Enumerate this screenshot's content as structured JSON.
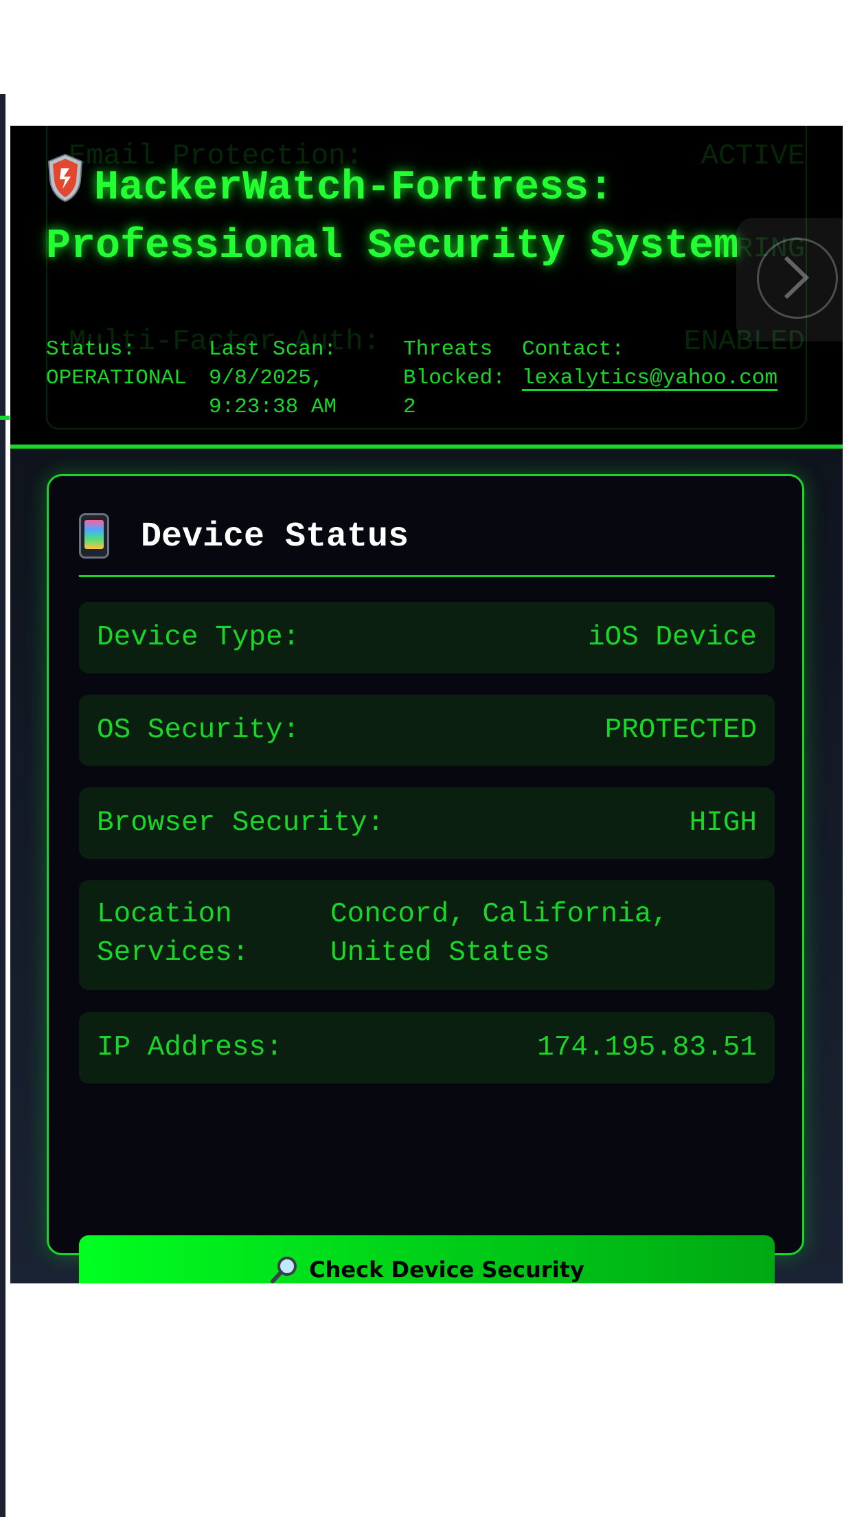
{
  "header": {
    "title": "HackerWatch-Fortress: Professional Security System",
    "background_rows": [
      {
        "label": "Email Protection:",
        "value": "ACTIVE"
      },
      {
        "label": "",
        "value": "ORING"
      },
      {
        "label": "Multi-Factor Auth:",
        "value": "ENABLED"
      }
    ],
    "status_label": "Status:",
    "status_value": "OPERATIONAL",
    "scan_label": "Last Scan:",
    "scan_value_line1": "9/8/2025,",
    "scan_value_line2": "9:23:38 AM",
    "threats_label_line1": "Threats",
    "threats_label_line2": "Blocked:",
    "threats_value": "2",
    "contact_label": "Contact:",
    "contact_email": "lexalytics@yahoo.com",
    "shield_icon": "shield-icon"
  },
  "nav": {
    "next_icon": "chevron-right-icon"
  },
  "device_status": {
    "title": "Device Status",
    "icon": "mobile-phone-icon",
    "rows": [
      {
        "label": "Device Type:",
        "value": "iOS Device"
      },
      {
        "label": "OS Security:",
        "value": "PROTECTED"
      },
      {
        "label": "Browser Security:",
        "value": "HIGH"
      },
      {
        "label": "Location Services:",
        "value": "Concord, California, United States"
      },
      {
        "label": "IP Address:",
        "value": "174.195.83.51"
      }
    ],
    "button_label": "Check Device Security",
    "button_icon": "magnifying-glass-icon"
  },
  "colors": {
    "accent": "#19d629",
    "bright_green": "#22ff32",
    "background": "#000000",
    "card_background": "#07080f",
    "row_background": "#0b1f10"
  }
}
